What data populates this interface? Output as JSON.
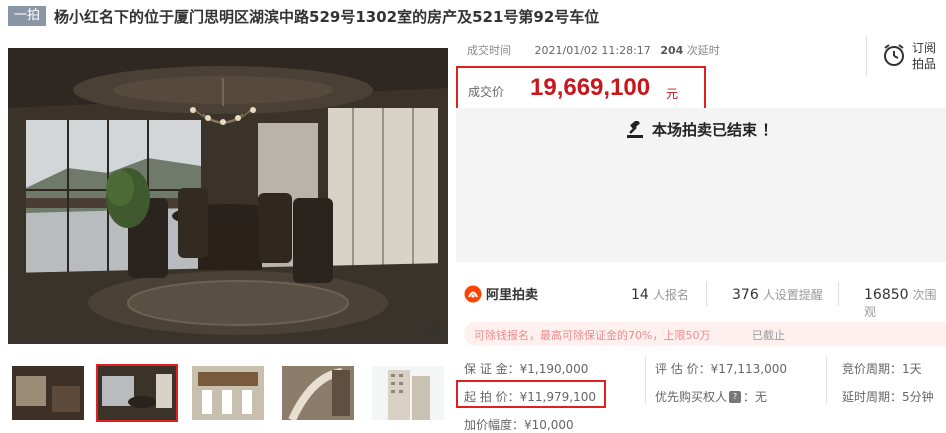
{
  "header": {
    "badge": "一拍",
    "title": "杨小红名下的位于厦门思明区湖滨中路529号1302室的房产及521号第92号车位"
  },
  "deal": {
    "time_label": "成交时间",
    "time_value": "2021/01/02 11:28:17",
    "delay_count": "204",
    "delay_label": "次延时",
    "price_label": "成交价",
    "price_value": "19,669,100",
    "price_unit": "元"
  },
  "subscribe": {
    "line1": "订阅",
    "line2": "拍品"
  },
  "status": {
    "ended_text": "本场拍卖已结束 ！"
  },
  "stats": {
    "brand": "阿里拍卖",
    "signups_num": "14",
    "signups_label": "人报名",
    "reminders_num": "376",
    "reminders_label": "人设置提醒",
    "views_num": "16850",
    "views_label": "次围观"
  },
  "notice": {
    "text": "可除钱报名，最高可除保证金的70%，上限50万",
    "stopped": "已截止"
  },
  "info": {
    "deposit": "保 证 金：¥1,190,000",
    "appraisal": "评 估 价：¥17,113,000",
    "cycle": "竞价周期：1天",
    "start_price": "起 拍 价：¥11,979,100",
    "priority_label": "优先购买权人",
    "priority_value": "：无",
    "delay_cycle": "延时周期：5分钟",
    "increment": "加价幅度：¥10,000"
  },
  "colors": {
    "accent_red": "#c8161d",
    "box_red": "#e02020",
    "badge_bg": "#8a96a6",
    "ali_orange": "#ff4400"
  }
}
